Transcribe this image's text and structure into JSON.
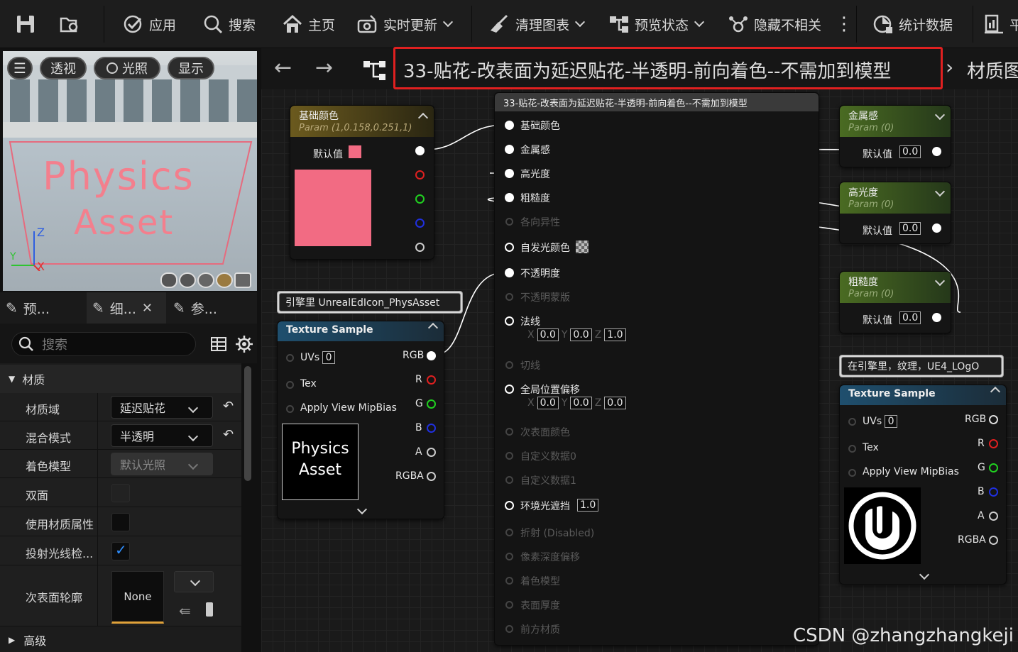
{
  "toolbar": {
    "apply": "应用",
    "search": "搜索",
    "home": "主页",
    "live_update": "实时更新",
    "clean_graph": "清理图表",
    "preview_state": "预览状态",
    "hide_unrelated": "隐藏不相关",
    "stats": "统计数据",
    "platform": "平"
  },
  "viewport": {
    "perspective": "透视",
    "lit": "光照",
    "show": "显示",
    "text_line1": "Physics",
    "text_line2": "Asset",
    "axis_z": "Z",
    "axis_x": "X",
    "axis_y": "Y"
  },
  "left_tabs": {
    "preview": "预...",
    "details": "细...",
    "params": "参..."
  },
  "search": {
    "placeholder": "搜索"
  },
  "details": {
    "category_material": "材质",
    "material_domain_label": "材质域",
    "material_domain_value": "延迟贴花",
    "blend_mode_label": "混合模式",
    "blend_mode_value": "半透明",
    "shading_model_label": "着色模型",
    "shading_model_value": "默认光照",
    "two_sided_label": "双面",
    "use_material_attributes_label": "使用材质属性",
    "cast_ray_label": "投射光线检...",
    "subsurface_label": "次表面轮廓",
    "subsurface_value": "None",
    "category_advanced": "高级"
  },
  "graph": {
    "breadcrumb": "33-贴花-改表面为延迟贴花-半透明-前向着色--不需加到模型",
    "breadcrumb_next": "材质图",
    "result_node_title": "33-贴花-改表面为延迟贴花-半透明-前向着色--不需加到模型",
    "result_pins": [
      {
        "label": "基础颜色",
        "enabled": true
      },
      {
        "label": "金属感",
        "enabled": true
      },
      {
        "label": "高光度",
        "enabled": true
      },
      {
        "label": "粗糙度",
        "enabled": true
      },
      {
        "label": "各向异性",
        "enabled": false
      },
      {
        "label": "自发光颜色",
        "enabled": true
      },
      {
        "label": "不透明度",
        "enabled": true
      },
      {
        "label": "不透明蒙版",
        "enabled": false
      },
      {
        "label": "法线",
        "enabled": true
      },
      {
        "label": "切线",
        "enabled": false
      },
      {
        "label": "全局位置偏移",
        "enabled": true
      },
      {
        "label": "次表面颜色",
        "enabled": false
      },
      {
        "label": "自定义数据0",
        "enabled": false
      },
      {
        "label": "自定义数据1",
        "enabled": false
      },
      {
        "label": "环境光遮挡",
        "enabled": true
      },
      {
        "label": "折射 (Disabled)",
        "enabled": false
      },
      {
        "label": "像素深度偏移",
        "enabled": false
      },
      {
        "label": "着色模型",
        "enabled": false
      },
      {
        "label": "表面厚度",
        "enabled": false
      },
      {
        "label": "前方材质",
        "enabled": false
      }
    ],
    "normal_vals": {
      "x": "0.0",
      "y": "0.0",
      "z": "1.0"
    },
    "wpo_vals": {
      "x": "0.0",
      "y": "0.0",
      "z": "0.0"
    },
    "ao_val": "1.0",
    "base_color_node": {
      "title": "基础颜色",
      "subtitle": "Param (1,0.158,0.251,1)",
      "default_label": "默认值",
      "swatch": "#f26b83"
    },
    "comment1": "引擎里 UnrealEdIcon_PhysAsset",
    "texture1": {
      "title": "Texture Sample",
      "uvs": "UVs",
      "uvs_val": "0",
      "tex": "Tex",
      "mip": "Apply View MipBias",
      "rgb": "RGB",
      "r": "R",
      "g": "G",
      "b": "B",
      "a": "A",
      "rgba": "RGBA",
      "thumb_line1": "Physics",
      "thumb_line2": "Asset"
    },
    "metallic_node": {
      "title": "金属感",
      "subtitle": "Param (0)",
      "default_label": "默认值",
      "value": "0.0"
    },
    "specular_node": {
      "title": "高光度",
      "subtitle": "Param (0)",
      "default_label": "默认值",
      "value": "0.0"
    },
    "roughness_node": {
      "title": "粗糙度",
      "subtitle": "Param (0)",
      "default_label": "默认值",
      "value": "0.0"
    },
    "comment2": "在引擎里，纹理，UE4_LOgO",
    "texture2": {
      "title": "Texture Sample",
      "uvs": "UVs",
      "uvs_val": "0",
      "tex": "Tex",
      "mip": "Apply View MipBias",
      "rgb": "RGB",
      "r": "R",
      "g": "G",
      "b": "B",
      "a": "A",
      "rgba": "RGBA"
    }
  },
  "watermark": "CSDN @zhangzhangkeji",
  "colors": {
    "highlight": "#e02020",
    "param_header": "#4a6b22",
    "base_header": "#6b5a1e",
    "texture_header": "#1f4f6e",
    "accent": "#e0a23a"
  }
}
